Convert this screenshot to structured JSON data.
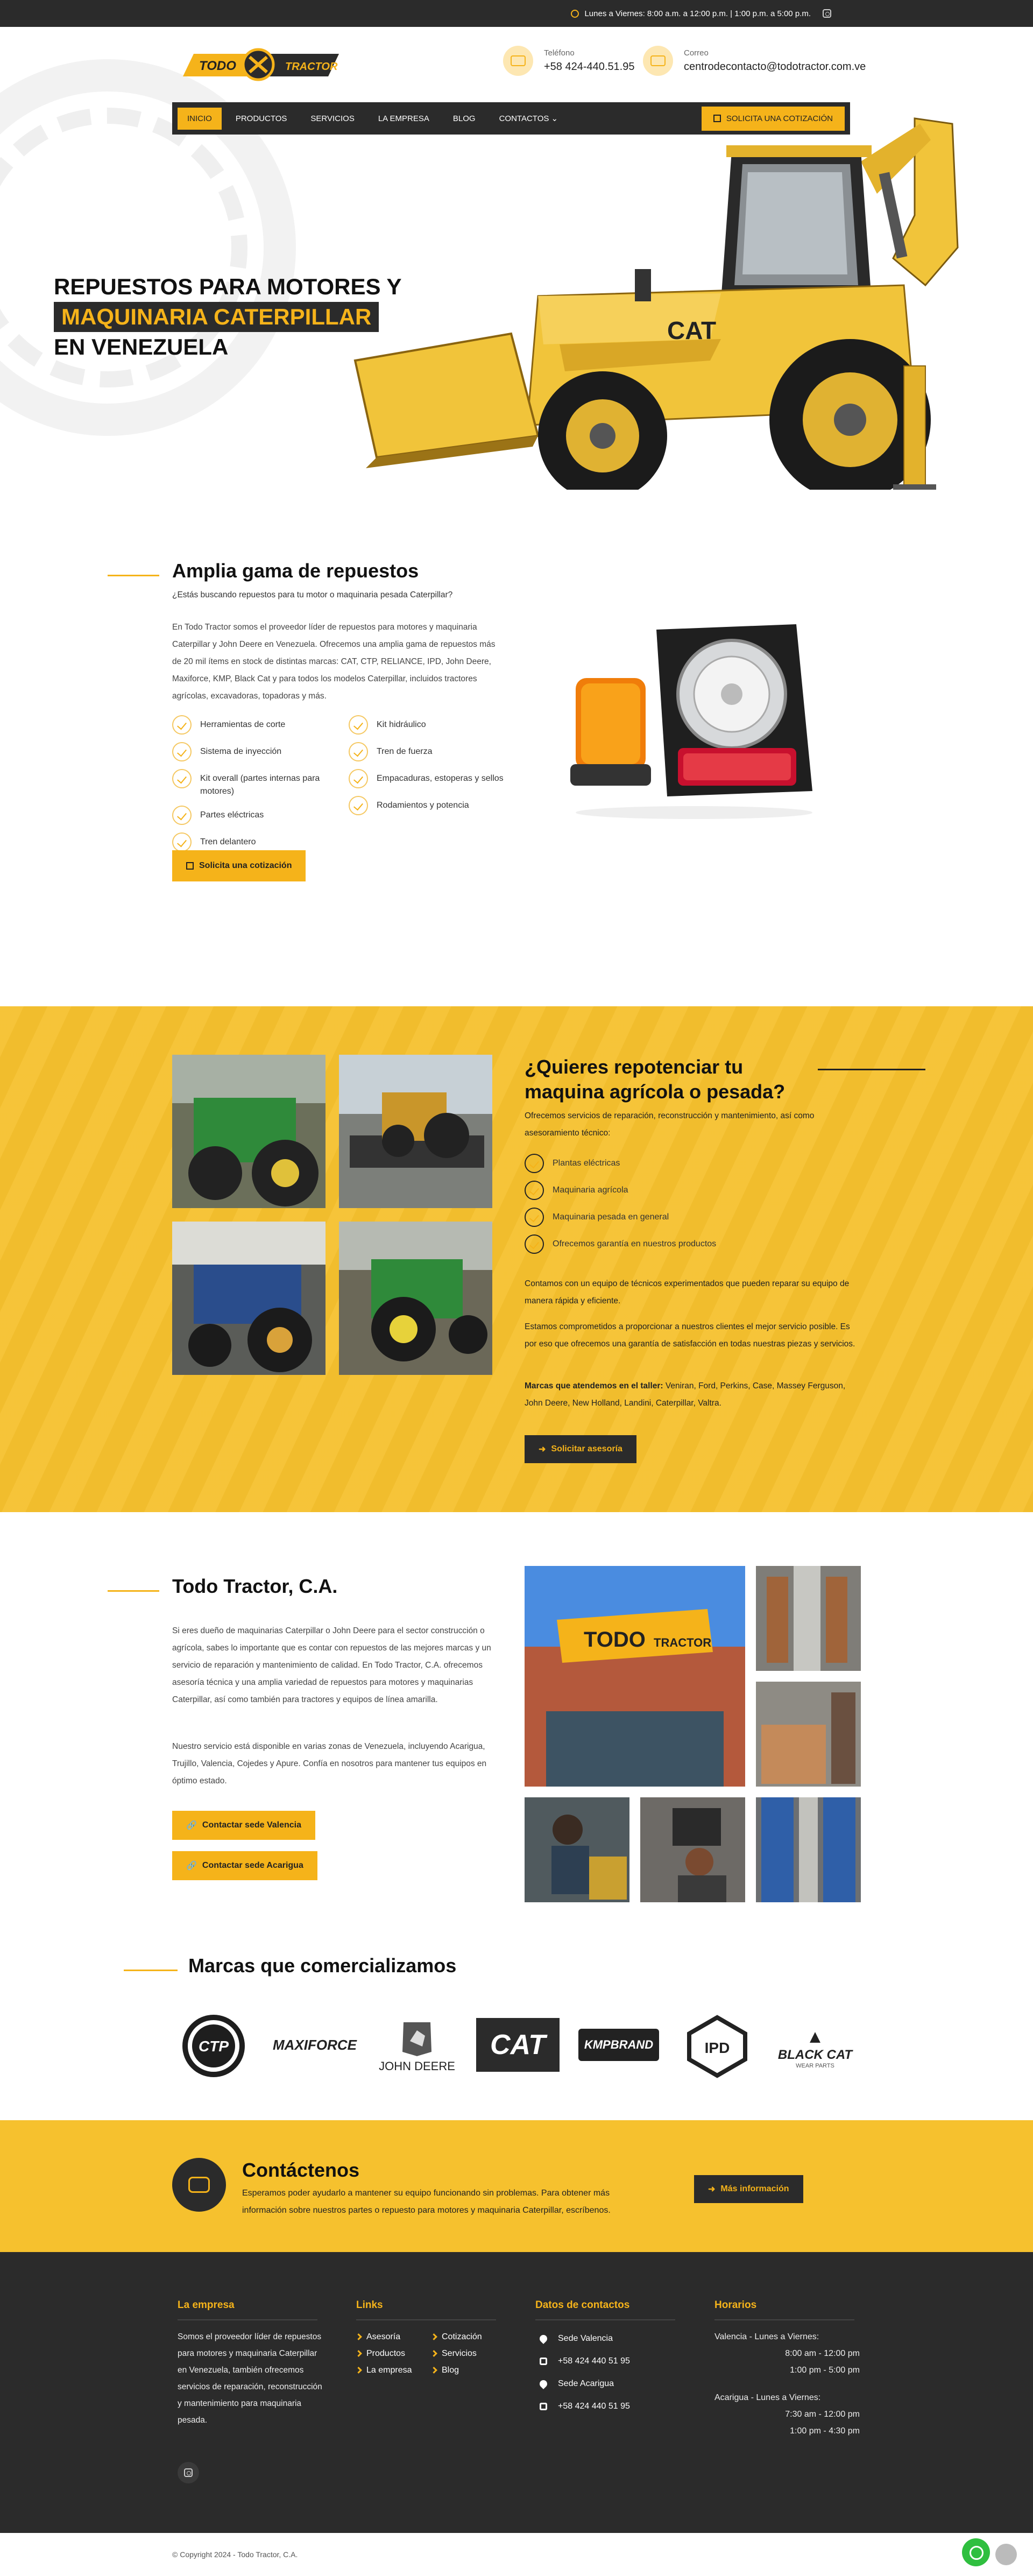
{
  "topbar": {
    "hours": "Lunes a Viernes: 8:00 a.m. a 12:00 p.m. | 1:00 p.m. a 5:00 p.m."
  },
  "header": {
    "logo_text_1": "TODO",
    "logo_text_2": "TRACTOR",
    "phone_label": "Teléfono",
    "phone_value": "+58 424-440.51.95",
    "email_label": "Correo",
    "email_value": "centrodecontacto@todotractor.com.ve"
  },
  "nav": {
    "items": [
      {
        "label": "INICIO"
      },
      {
        "label": "PRODUCTOS"
      },
      {
        "label": "SERVICIOS"
      },
      {
        "label": "LA EMPRESA"
      },
      {
        "label": "BLOG"
      },
      {
        "label": "CONTACTOS"
      }
    ],
    "quote_label": "SOLICITA UNA COTIZACIÓN"
  },
  "hero": {
    "line1": "REPUESTOS PARA MOTORES Y",
    "line2": "MAQUINARIA CATERPILLAR",
    "line3": "EN VENEZUELA"
  },
  "range": {
    "title": "Amplia gama de repuestos",
    "subtitle": "¿Estás buscando repuestos para tu motor o maquinaria pesada Caterpillar?",
    "body": "En Todo Tractor somos el proveedor líder de repuestos para motores y maquinaria Caterpillar y John Deere en Venezuela. Ofrecemos una amplia gama de repuestos más de 20 mil ítems en stock de distintas marcas: CAT, CTP, RELIANCE, IPD, John Deere, Maxiforce, KMP, Black Cat y para todos los modelos Caterpillar, incluidos tractores agrícolas, excavadoras, topadoras y más.",
    "col1": [
      "Herramientas de corte",
      "Sistema de inyección",
      "Kit overall (partes internas para motores)",
      "Partes eléctricas",
      "Tren delantero"
    ],
    "col2": [
      "Kit hidráulico",
      "Tren de fuerza",
      "Empacaduras, estoperas y sellos",
      "Rodamientos y potencia"
    ],
    "button": "Solicita una cotización"
  },
  "repower": {
    "title": "¿Quieres repotenciar tu maquina agrícola o pesada?",
    "intro": "Ofrecemos servicios de reparación, reconstrucción y mantenimiento, así como asesoramiento técnico:",
    "items": [
      "Plantas eléctricas",
      "Maquinaria agrícola",
      "Maquinaria pesada en general",
      "Ofrecemos garantía en nuestros productos"
    ],
    "p1": "Contamos con un equipo de técnicos experimentados que pueden reparar su equipo de manera rápida y eficiente.",
    "p2": "Estamos comprometidos a proporcionar a nuestros clientes el mejor servicio posible. Es por eso que ofrecemos una garantía de satisfacción en todas nuestras piezas y servicios.",
    "brands_label": "Marcas que atendemos en el taller:",
    "brands_value": " Veniran, Ford, Perkins, Case, Massey Ferguson, John Deere, New Holland, Landini, Caterpillar, Valtra.",
    "button": "Solicitar asesoría"
  },
  "company": {
    "title": "Todo Tractor, C.A.",
    "p1": "Si eres dueño de maquinarias Caterpillar o John Deere para el sector construcción o agrícola, sabes lo importante que es contar con repuestos de las mejores marcas y un servicio de reparación y mantenimiento de calidad. En Todo Tractor, C.A. ofrecemos asesoría técnica y una amplia variedad de repuestos para motores y maquinarias Caterpillar, así como también para tractores y equipos de línea amarilla.",
    "p2": "Nuestro servicio está disponible en varias zonas de Venezuela, incluyendo Acarigua, Trujillo, Valencia, Cojedes y Apure. Confía en nosotros para mantener tus equipos en óptimo estado.",
    "btn1": "Contactar sede Valencia",
    "btn2": "Contactar sede Acarigua",
    "sign_1": "TODO",
    "sign_2": "TRACTOR"
  },
  "brands": {
    "title": "Marcas que comercializamos",
    "logos": [
      {
        "name": "CTP",
        "sub": "Quality Product"
      },
      {
        "name": "MAXIFORCE",
        "sub": ""
      },
      {
        "name": "JOHN DEERE",
        "sub": ""
      },
      {
        "name": "CAT",
        "sub": ""
      },
      {
        "name": "KMPBRAND",
        "sub": ""
      },
      {
        "name": "IPD",
        "sub": ""
      },
      {
        "name": "BLACK CAT",
        "sub": "WEAR PARTS"
      }
    ]
  },
  "cta": {
    "title": "Contáctenos",
    "text": "Esperamos poder ayudarlo a mantener su equipo funcionando sin problemas. Para obtener más información sobre nuestros partes o repuesto para motores y maquinaria Caterpillar, escríbenos.",
    "button": "Más información"
  },
  "footer": {
    "about_title": "La empresa",
    "about_text": "Somos el proveedor líder de repuestos para motores y maquinaria Caterpillar en Venezuela, también ofrecemos servicios de reparación, reconstrucción y mantenimiento para maquinaria pesada.",
    "links_title": "Links",
    "links_col1": [
      "Asesoría",
      "Productos",
      "La empresa"
    ],
    "links_col2": [
      "Cotización",
      "Servicios",
      "Blog"
    ],
    "contact_title": "Datos de contactos",
    "contacts": [
      {
        "type": "pin",
        "text": "Sede Valencia"
      },
      {
        "type": "phone",
        "text": "+58 424 440 51 95"
      },
      {
        "type": "pin",
        "text": "Sede Acarigua"
      },
      {
        "type": "phone",
        "text": "+58 424 440 51 95"
      }
    ],
    "hours_title": "Horarios",
    "hours_valencia": "Valencia - Lunes a Viernes:",
    "hours_v1": "8:00 am - 12:00 pm",
    "hours_v2": "1:00 pm - 5:00 pm",
    "hours_acarigua": "Acarigua - Lunes a Viernes:",
    "hours_a1": "7:30 am - 12:00 pm",
    "hours_a2": "1:00 pm - 4:30 pm",
    "copyright": "© Copyright 2024 - Todo Tractor, C.A."
  },
  "colors": {
    "accent": "#f5b31a",
    "dark": "#2b2b2b",
    "yellow_bg": "#f6c12e"
  }
}
